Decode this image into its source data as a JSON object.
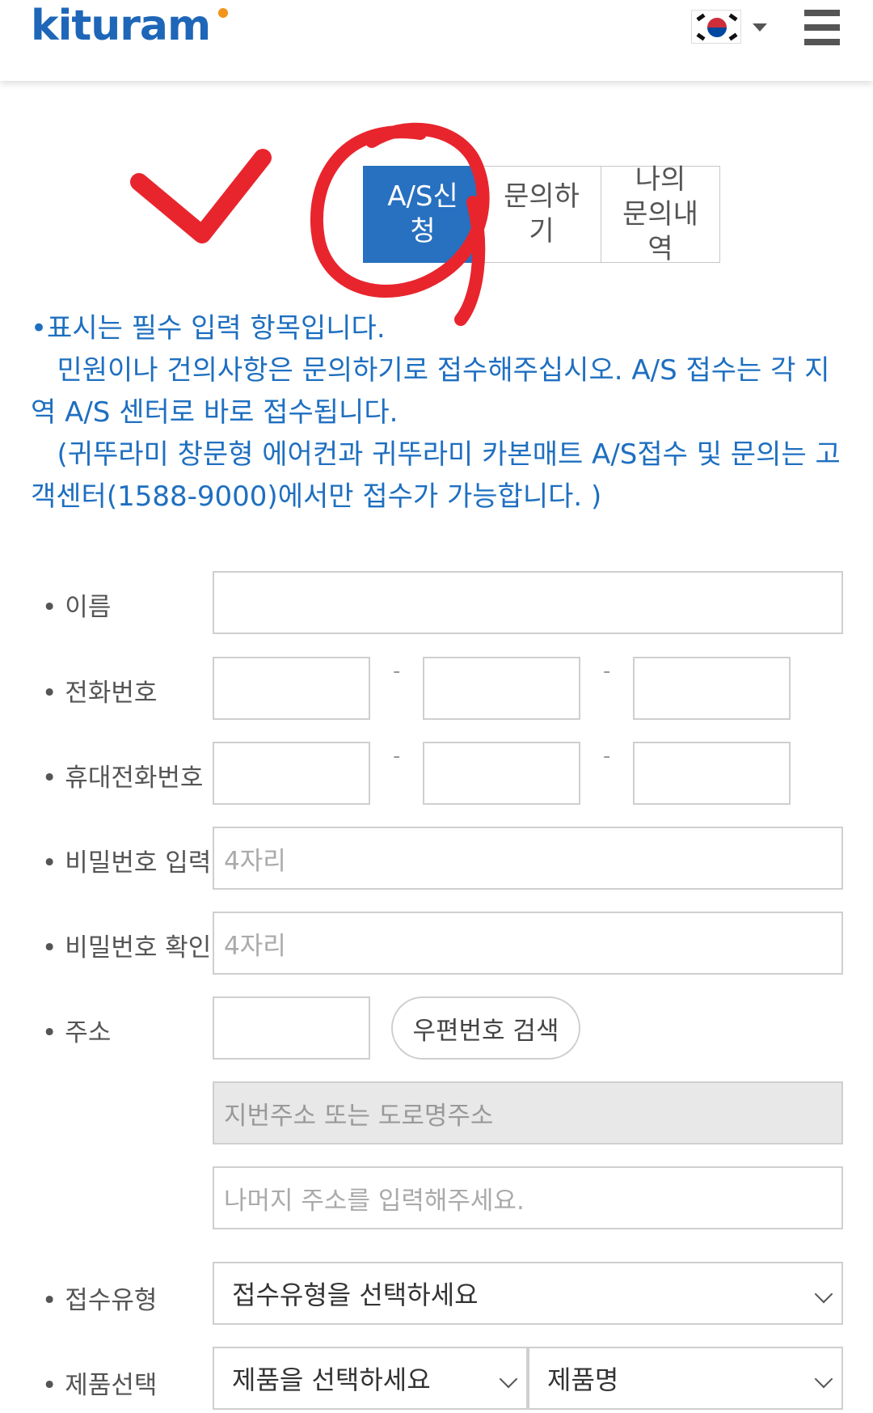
{
  "header": {
    "logo_text": "kituram",
    "language": {
      "flag_icon": "korea-flag-icon",
      "selector_icon": "caret-down-icon"
    },
    "menu_icon": "hamburger-menu-icon"
  },
  "tabs": [
    {
      "label": "A/S신\n청",
      "active": true
    },
    {
      "label": "문의하\n기",
      "active": false
    },
    {
      "label": "나의\n문의내\n역",
      "active": false
    }
  ],
  "notice": {
    "line1": "•표시는 필수 입력 항목입니다.",
    "line2": "   민원이나 건의사항은 문의하기로 접수해주십시오. A/S 접수는 각 지역 A/S 센터로 바로 접수됩니다.",
    "line3": "   (귀뚜라미 창문형 에어컨과 귀뚜라미 카본매트 A/S접수 및 문의는 고객센터(1588-9000)에서만 접수가 가능합니다. )"
  },
  "form": {
    "name_label": "이름",
    "phone_label": "전화번호",
    "mobile_label": "휴대전화번호",
    "password_label": "비밀번호 입력",
    "password_placeholder": "4자리",
    "password_confirm_label": "비밀번호 확인",
    "password_confirm_placeholder": "4자리",
    "address_label": "주소",
    "postcode_button": "우편번호 검색",
    "address_placeholder": "지번주소 또는 도로명주소",
    "address_detail_placeholder": "나머지 주소를 입력해주세요.",
    "dash": "-",
    "receipt_type_label": "접수유형",
    "receipt_type_value": "접수유형을 선택하세요",
    "product_label": "제품선택",
    "product_value": "제품을 선택하세요",
    "product_name_value": "제품명"
  },
  "colors": {
    "brand_blue": "#1e66b8",
    "tab_active": "#2870c0",
    "notice_text": "#1e6fc0",
    "annotation_red": "#e8252d",
    "logo_accent": "#f29419"
  }
}
